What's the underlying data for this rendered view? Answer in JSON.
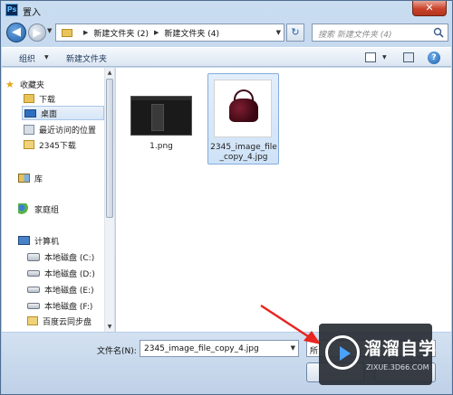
{
  "window": {
    "title": "置入",
    "app_icon_text": "Ps",
    "close_glyph": "✕"
  },
  "address": {
    "back_glyph": "◀",
    "forward_glyph": "▶",
    "sep_glyph": "▶",
    "crumbs": [
      "新建文件夹 (2)",
      "新建文件夹 (4)"
    ],
    "refresh_glyph": "↻",
    "search_placeholder": "搜索 新建文件夹 (4)"
  },
  "toolbar": {
    "organize_label": "组织",
    "new_folder_label": "新建文件夹",
    "help_glyph": "?"
  },
  "sidebar": {
    "favorites": "收藏夹",
    "downloads": "下载",
    "desktop": "桌面",
    "recent": "最近访问的位置",
    "downloads_2345": "2345下载",
    "libraries": "库",
    "homegroup": "家庭组",
    "computer": "计算机",
    "drive_c": "本地磁盘 (C:)",
    "drive_d": "本地磁盘 (D:)",
    "drive_e": "本地磁盘 (E:)",
    "drive_f": "本地磁盘 (F:)",
    "baidu_sync": "百度云同步盘"
  },
  "files": [
    {
      "name": "1.png"
    },
    {
      "name_line1": "2345_image_file",
      "name_line2": "_copy_4.jpg"
    }
  ],
  "bottom": {
    "filename_label": "文件名(N):",
    "filename_value": "2345_image_file_copy_4.jpg",
    "type_value": "所"
  },
  "watermark": {
    "title": "溜溜自学",
    "url": "ZIXUE.3D66.COM"
  },
  "colors": {
    "accent": "#1e5fa8",
    "annotation_arrow": "#e8251f"
  }
}
